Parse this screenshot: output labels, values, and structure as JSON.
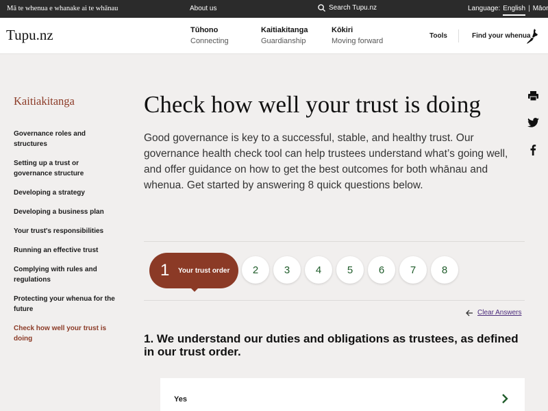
{
  "topbar": {
    "tagline": "Mā te whenua e whanake ai te whānau",
    "about": "About us",
    "search": "Search Tupu.nz",
    "language_label": "Language:",
    "lang_english": "English",
    "lang_sep": "|",
    "lang_maori": "Māori"
  },
  "header": {
    "logo": "Tupu.nz",
    "nav": [
      {
        "title": "Tūhono",
        "sub": "Connecting"
      },
      {
        "title": "Kaitiakitanga",
        "sub": "Guardianship"
      },
      {
        "title": "Kōkiri",
        "sub": "Moving forward"
      }
    ],
    "tools": "Tools",
    "find_whenua": "Find your whenua"
  },
  "sidebar": {
    "heading": "Kaitiakitanga",
    "items": [
      "Governance roles and structures",
      "Setting up a trust or governance structure",
      "Developing a strategy",
      "Developing a business plan",
      "Your trust's responsibilities",
      "Running an effective trust",
      "Complying with rules and regulations",
      "Protecting your whenua for the future",
      "Check how well your trust is doing"
    ]
  },
  "main": {
    "title": "Check how well your trust is doing",
    "intro": "Good governance is key to a successful, stable, and healthy trust. Our governance health check tool can help trustees understand what’s going well, and offer guidance on how to get the best outcomes for both whānau and whenua. Get started by answering 8 quick questions below."
  },
  "steps": {
    "active_num": "1",
    "active_label": "Your trust order",
    "others": [
      "2",
      "3",
      "4",
      "5",
      "6",
      "7",
      "8"
    ]
  },
  "clear_answers": "Clear Answers",
  "question": "1. We understand our duties and obligations as trustees, as defined in our trust order.",
  "answers": [
    "Yes"
  ],
  "icons": [
    "search-icon",
    "nz-map-icon",
    "print-icon",
    "twitter-icon",
    "facebook-icon",
    "arrow-left-icon",
    "chevron-right-icon"
  ],
  "colors": {
    "accent": "#8b3a26",
    "step_text": "#1f5c2a",
    "link": "#4a2a7a",
    "topbar": "#2b2b2b"
  }
}
